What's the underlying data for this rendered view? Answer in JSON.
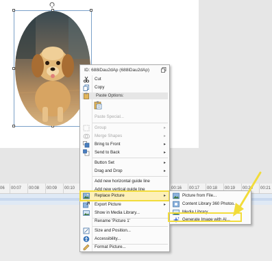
{
  "colors": {
    "highlight": "#f2dc3a",
    "selection": "#7aa0c8",
    "menu_bg": "#fbfbfb"
  },
  "context_menu": {
    "header_id": "ID: 688iDau2dAp (688iDau2dAp)",
    "items": {
      "cut": "Cut",
      "copy": "Copy",
      "paste_options": "Paste Options:",
      "paste_special": "Paste Special...",
      "group": "Group",
      "merge_shapes": "Merge Shapes",
      "bring_to_front": "Bring to Front",
      "send_to_back": "Send to Back",
      "button_set": "Button Set",
      "drag_and_drop": "Drag and Drop",
      "add_horizontal_guide": "Add new horizontal guide line",
      "add_vertical_guide": "Add new vertical guide line",
      "replace_picture": "Replace Picture",
      "export_picture": "Export Picture",
      "show_in_media_library": "Show in Media Library...",
      "rename": "Rename 'Picture 1'",
      "size_and_position": "Size and Position...",
      "accessibility": "Accessibility...",
      "format_picture": "Format Picture..."
    }
  },
  "submenu": {
    "items": {
      "picture_from_file": "Picture from File...",
      "content_library": "Content Library 360 Photos...",
      "media_library": "Media Library...",
      "generate_ai": "Generate Image with AI..."
    }
  },
  "timeline": {
    "ticks_left": [
      "06",
      "00:07",
      "00:08",
      "00:09",
      "00:10"
    ],
    "ticks_right": [
      "00:16",
      "00:17",
      "00:18",
      "00:19",
      "00:20",
      "00:21"
    ]
  }
}
